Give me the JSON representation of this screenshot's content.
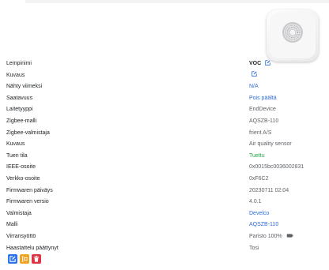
{
  "colors": {
    "link": "#2f6bd9",
    "success": "#28a745",
    "edit_button": "#2f74e6",
    "rename_button": "#f0a424",
    "delete_button": "#dc3545"
  },
  "device_image": {
    "icon": "air-quality-sensor-image"
  },
  "rows": [
    {
      "label": "Lempinimi",
      "value": "VOC",
      "style": "strong",
      "icon": "edit-icon"
    },
    {
      "label": "Kuvaus",
      "value": "",
      "style": "link",
      "icon": "edit-icon"
    },
    {
      "label": "Nähty viimeksi",
      "value": "N/A",
      "style": "link"
    },
    {
      "label": "Saatavuus",
      "value": "Pois päältä",
      "style": "link"
    },
    {
      "label": "Laitetyyppi",
      "value": "EndDevice",
      "style": "plain"
    },
    {
      "label": "Zigbee-malli",
      "value": "AQSZB-110",
      "style": "plain"
    },
    {
      "label": "Zigbee-valmistaja",
      "value": "frient A/S",
      "style": "plain"
    },
    {
      "label": "Kuvaus",
      "value": "Air quality sensor",
      "style": "plain"
    },
    {
      "label": "Tuen tila",
      "value": "Tuettu",
      "style": "green"
    },
    {
      "label": "IEEE-osoite",
      "value": "0x0015bc0036002831",
      "style": "plain"
    },
    {
      "label": "Verkko-osoite",
      "value": "0xF6C2",
      "style": "plain"
    },
    {
      "label": "Firmwaren päiväys",
      "value": "20230711 02:04",
      "style": "plain"
    },
    {
      "label": "Firmwaren versio",
      "value": "4.0.1",
      "style": "plain"
    },
    {
      "label": "Valmistaja",
      "value": "Develco",
      "style": "link"
    },
    {
      "label": "Malli",
      "value": "AQSZB-110",
      "style": "link"
    },
    {
      "label": "Virransyöttö",
      "value": "Paristo 100%",
      "style": "plain",
      "icon": "battery-icon"
    },
    {
      "label": "Haastattelu päättynyt",
      "value": "Tosi",
      "style": "plain"
    }
  ],
  "action_buttons": [
    {
      "name": "edit-device-button",
      "icon": "pencil-icon"
    },
    {
      "name": "rename-device-button",
      "icon": "rename-icon"
    },
    {
      "name": "delete-device-button",
      "icon": "trash-icon"
    }
  ]
}
